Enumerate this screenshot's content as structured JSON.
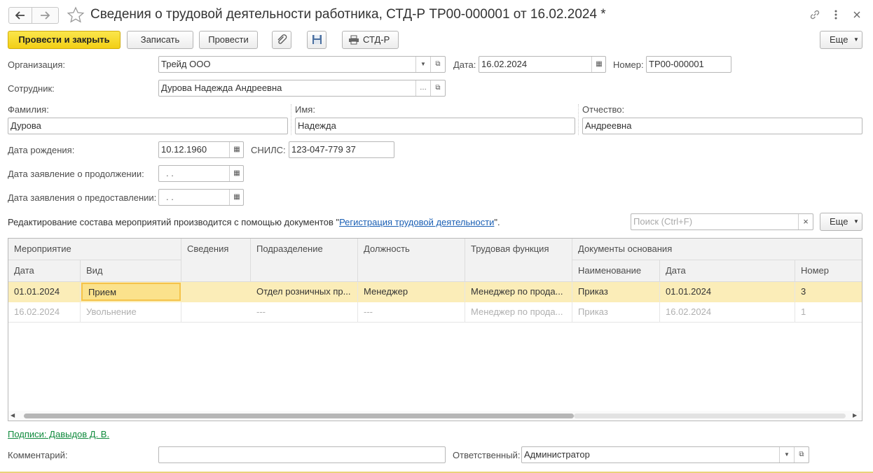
{
  "window": {
    "title": "Сведения о трудовой деятельности работника, СТД-Р ТР00-000001 от 16.02.2024 *"
  },
  "toolbar": {
    "post_close": "Провести и закрыть",
    "save": "Записать",
    "post": "Провести",
    "print_std": "СТД-Р",
    "more": "Еще"
  },
  "form": {
    "org_label": "Организация:",
    "org_value": "Трейд ООО",
    "date_label": "Дата:",
    "date_value": "16.02.2024",
    "number_label": "Номер:",
    "number_value": "ТР00-000001",
    "employee_label": "Сотрудник:",
    "employee_value": "Дурова Надежда Андреевна",
    "lastname_label": "Фамилия:",
    "lastname_value": "Дурова",
    "firstname_label": "Имя:",
    "firstname_value": "Надежда",
    "patronymic_label": "Отчество:",
    "patronymic_value": "Андреевна",
    "birth_label": "Дата рождения:",
    "birth_value": "10.12.1960",
    "snils_label": "СНИЛС:",
    "snils_value": "123-047-779 37",
    "cont_label": "Дата заявление о продолжении:",
    "cont_value": " .  .",
    "prov_label": "Дата заявления о предоставлении:",
    "prov_value": " .  .",
    "info_prefix": "Редактирование состава мероприятий производится с помощью документов \"",
    "info_link": "Регистрация трудовой деятельности",
    "info_suffix": "\".",
    "search_placeholder": "Поиск (Ctrl+F)",
    "search_clear": "×",
    "more2": "Еще"
  },
  "table": {
    "headers": {
      "event": "Мероприятие",
      "date": "Дата",
      "kind": "Вид",
      "info": "Сведения",
      "dept": "Подразделение",
      "position": "Должность",
      "func": "Трудовая функция",
      "docs": "Документы основания",
      "doc_name": "Наименование",
      "doc_date": "Дата",
      "doc_number": "Номер"
    },
    "rows": [
      {
        "date": "01.01.2024",
        "kind": "Прием",
        "info": "",
        "dept": "Отдел розничных пр...",
        "position": "Менеджер",
        "func": "Менеджер по прода...",
        "doc_name": "Приказ",
        "doc_date": "01.01.2024",
        "doc_number": "3"
      },
      {
        "date": "16.02.2024",
        "kind": "Увольнение",
        "info": "",
        "dept": "---",
        "position": "---",
        "func": "Менеджер по прода...",
        "doc_name": "Приказ",
        "doc_date": "16.02.2024",
        "doc_number": "1"
      }
    ]
  },
  "footer": {
    "signatures": "Подписи: Давыдов Д. В.",
    "comment_label": "Комментарий:",
    "comment_value": "",
    "responsible_label": "Ответственный:",
    "responsible_value": "Администратор"
  },
  "colors": {
    "primary_button": "#f2cf15",
    "selected_row": "#fbedb8",
    "link": "#1a5fb4",
    "signature_link": "#0f8a3c"
  }
}
